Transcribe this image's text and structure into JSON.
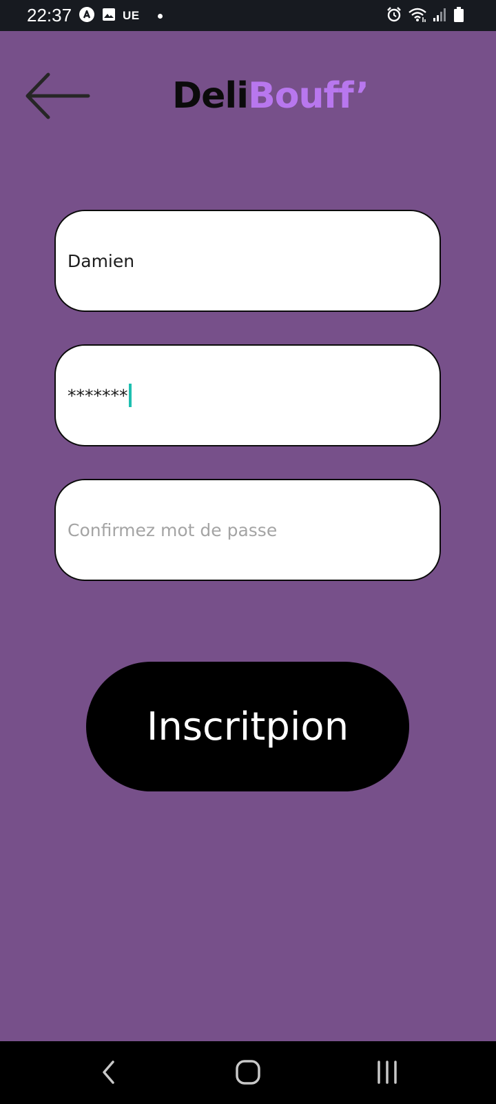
{
  "status_bar": {
    "time": "22:37",
    "carrier": "UE",
    "icons": [
      "app-notification-icon",
      "gallery-icon",
      "dot-icon",
      "alarm-icon",
      "wifi-icon",
      "signal-icon",
      "battery-icon"
    ]
  },
  "header": {
    "logo_part1": "Deli",
    "logo_part2": "Bouff’",
    "logo_colors": {
      "part1": "#0b0b0b",
      "part2": "#b877ee"
    },
    "back_icon": "arrow-left-icon"
  },
  "form": {
    "username_value": "Damien",
    "password_value": "*******",
    "confirm_placeholder": "Confirmez mot de passe",
    "submit_label": "Inscritpion"
  },
  "theme": {
    "background": "#77508a",
    "caret_color": "#1dbfb0",
    "button_color": "#000000"
  },
  "nav_bar": {
    "buttons": [
      "back-nav-icon",
      "home-nav-icon",
      "recents-nav-icon"
    ]
  }
}
